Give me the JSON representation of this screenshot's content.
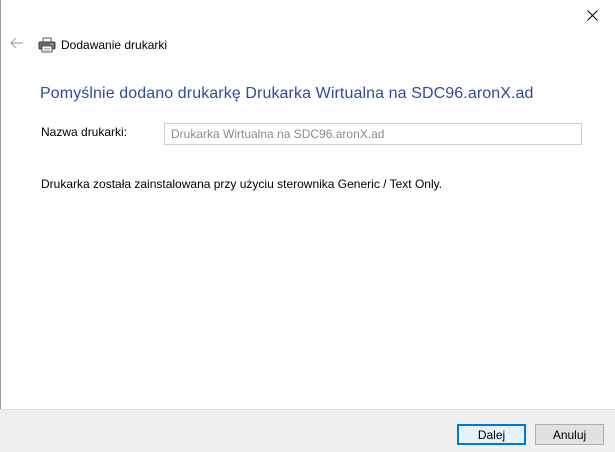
{
  "window": {
    "close_icon": "close-icon"
  },
  "nav": {
    "back_icon": "back-arrow-icon",
    "wizard_icon": "printer-icon",
    "title": "Dodawanie drukarki"
  },
  "main": {
    "heading": "Pomyślnie dodano drukarkę Drukarka Wirtualna na SDC96.aronX.ad",
    "printer_name_label": "Nazwa drukarki:",
    "printer_name_value": "Drukarka Wirtualna na SDC96.aronX.ad",
    "driver_info": "Drukarka została zainstalowana przy użyciu sterownika Generic / Text Only."
  },
  "footer": {
    "next_label": "Dalej",
    "cancel_label": "Anuluj"
  },
  "colors": {
    "heading": "#2a4d9b",
    "focus_border": "#0078d7",
    "footer_bg": "#f0f0f0"
  }
}
